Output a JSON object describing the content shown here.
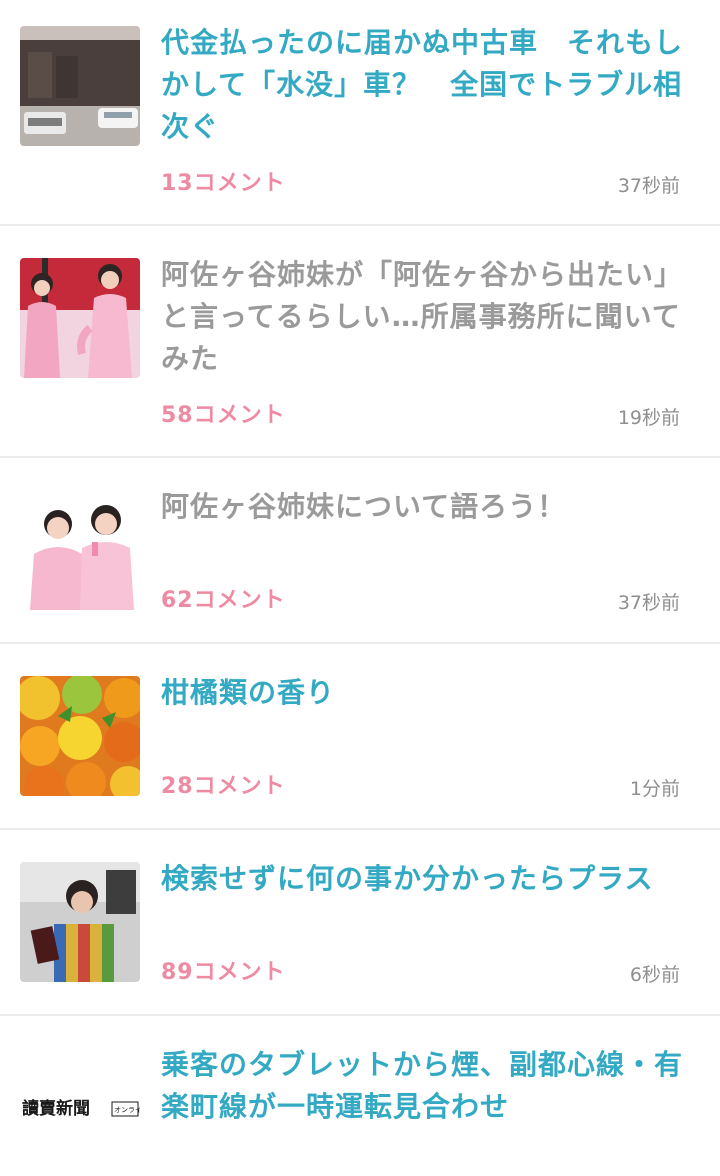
{
  "topics": [
    {
      "title": "代金払ったのに届かぬ中古車　それもしかして「水没」車？　全国でトラブル相次ぐ",
      "comments": "13コメント",
      "time": "37秒前",
      "read": false,
      "thumbnail": "building-parking-lot-photo"
    },
    {
      "title": "阿佐ヶ谷姉妹が「阿佐ヶ谷から出たい」と言ってるらしい…所属事務所に聞いてみた",
      "comments": "58コメント",
      "time": "19秒前",
      "read": true,
      "thumbnail": "two-women-pink-dresses-stage-photo"
    },
    {
      "title": "阿佐ヶ谷姉妹について語ろう！",
      "comments": "62コメント",
      "time": "37秒前",
      "read": true,
      "thumbnail": "two-women-pink-dresses-photo"
    },
    {
      "title": "柑橘類の香り",
      "comments": "28コメント",
      "time": "1分前",
      "read": false,
      "thumbnail": "citrus-fruits-photo"
    },
    {
      "title": "検索せずに何の事か分かったらプラス",
      "comments": "89コメント",
      "time": "6秒前",
      "read": false,
      "thumbnail": "person-holding-book-photo"
    },
    {
      "title": "乗客のタブレットから煙、副都心線・有楽町線が一時運転見合わせ",
      "comments": "",
      "time": "",
      "read": false,
      "thumbnail": "newspaper-logo",
      "thumbnail_text": "讀賣新聞",
      "thumbnail_subtext": "オンライ"
    }
  ],
  "colors": {
    "unread_title": "#33a9c3",
    "read_title": "#9a9a9a",
    "comments": "#ee8aa2",
    "time": "#8f8f8f",
    "divider": "#ececec"
  }
}
